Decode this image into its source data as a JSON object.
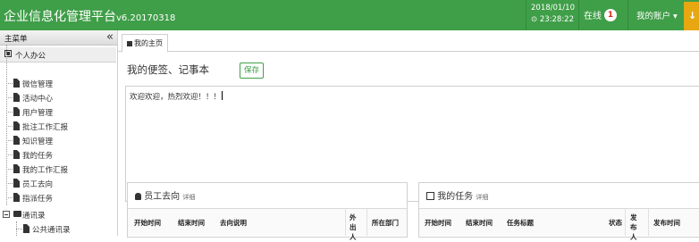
{
  "header": {
    "title": "企业信息化管理平台",
    "version": "v6.20170318",
    "date": "2018/01/10",
    "time": "⊙ 23:28:22",
    "online_label": "在线",
    "online_count": "1",
    "account_label": "我的账户 ▾",
    "yellow_char": "↓",
    "colors": {
      "header_bg": "#3f9e48",
      "accent": "#e6a711",
      "badge": "#d9261c"
    }
  },
  "sidebar": {
    "title": "主菜单",
    "collapse_icon": "«",
    "group": "个人办公",
    "items": [
      {
        "label": "微信管理"
      },
      {
        "label": "活动中心"
      },
      {
        "label": "用户管理"
      },
      {
        "label": "批注工作汇报"
      },
      {
        "label": "知识管理"
      },
      {
        "label": "我的任务"
      },
      {
        "label": "我的工作汇报"
      },
      {
        "label": "员工去向"
      },
      {
        "label": "指派任务"
      }
    ],
    "folder": "通讯录",
    "sub_item": "公共通讯录"
  },
  "main": {
    "tab": "我的主页",
    "note_title": "我的便签、记事本",
    "save_label": "保存",
    "note_text": "欢迎欢迎，热烈欢迎！！！",
    "panel_left": {
      "title": "员工去向",
      "more": "详细",
      "columns": [
        "开始时间",
        "结束时间",
        "去向说明",
        "外出人",
        "所在部门"
      ]
    },
    "panel_right": {
      "title": "我的任务",
      "more": "详细",
      "columns": [
        "开始时间",
        "结束时间",
        "任务标题",
        "状态",
        "发布人",
        "发布时间"
      ]
    }
  }
}
